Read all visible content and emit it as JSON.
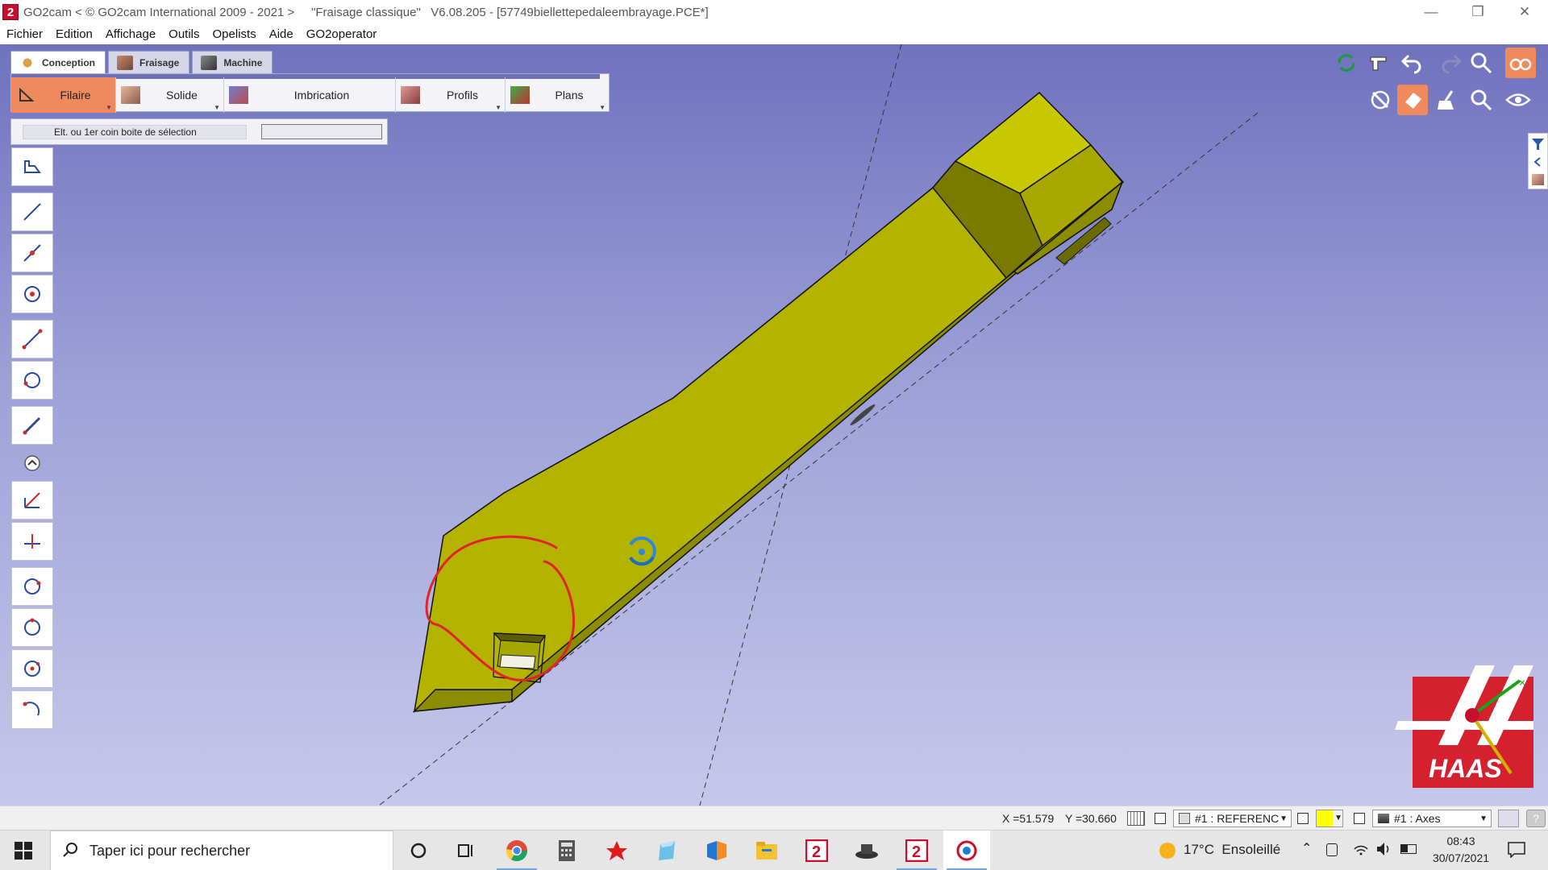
{
  "window": {
    "title": "GO2cam < © GO2cam International 2009 - 2021 >     \"Fraisage classique\"   V6.08.205 - [57749biellettepedaleembrayage.PCE*]",
    "app_icon_glyph": "2",
    "controls": {
      "minimize": "—",
      "restore": "❐",
      "close": "✕"
    }
  },
  "menu": [
    "Fichier",
    "Edition",
    "Affichage",
    "Outils",
    "Opelists",
    "Aide",
    "GO2operator"
  ],
  "tabs": [
    {
      "label": "Conception",
      "icon": "conception-icon",
      "active": true
    },
    {
      "label": "Fraisage",
      "icon": "milling-icon",
      "active": false
    },
    {
      "label": "Machine",
      "icon": "machine-icon",
      "active": false
    }
  ],
  "ribbon": [
    {
      "label": "Filaire",
      "icon": "wireframe-icon",
      "active": true
    },
    {
      "label": "Solide",
      "icon": "solid-icon",
      "active": false
    },
    {
      "label": "Imbrication",
      "icon": "nesting-icon",
      "active": false
    },
    {
      "label": "Profils",
      "icon": "profile-icon",
      "active": false
    },
    {
      "label": "Plans",
      "icon": "plane-icon",
      "active": false
    }
  ],
  "prompt": {
    "label": "Elt. ou 1er coin boite de sélection",
    "value": ""
  },
  "left_tools": [
    "select-icon",
    "line-icon",
    "line-2pt-icon",
    "point-icon",
    "segment-icon",
    "arc-icon",
    "pen-icon",
    "chevron-up-icon",
    "axis-icon",
    "perpendicular-icon",
    "circle-icon",
    "circle-2-icon",
    "circle-center-icon",
    "arc-end-icon"
  ],
  "top_tools_row1": [
    "regenerate-icon",
    "pointer-icon",
    "undo-icon",
    "redo-icon",
    "zoom-icon",
    "glasses-icon"
  ],
  "top_tools_row2": [
    "visibility-icon",
    "eraser-icon",
    "broom-icon",
    "zoom-window-icon",
    "eye-icon"
  ],
  "status": {
    "x": "X =51.579",
    "y": "Y =30.660",
    "reference": "#1 : REFERENC",
    "layer": "#1 : Axes",
    "color": "#ffff00"
  },
  "taskbar": {
    "search_placeholder": "Taper ici pour rechercher",
    "weather": "17°C  Ensoleillé",
    "time": "08:43",
    "date": "30/07/2021",
    "apps": [
      "cortana-icon",
      "task-view-icon",
      "chrome-icon",
      "calculator-icon",
      "app-red-star-icon",
      "app-blue-icon",
      "app-ms-icon",
      "file-explorer-icon",
      "go2cam-icon",
      "app-hat-icon",
      "go2cam-active-icon",
      "app-cam-icon"
    ]
  },
  "colors": {
    "accent_orange": "#f08a5d",
    "part_yellow": "#b4b400",
    "sketch_red": "#e0242a",
    "haas_red": "#d5202e"
  }
}
